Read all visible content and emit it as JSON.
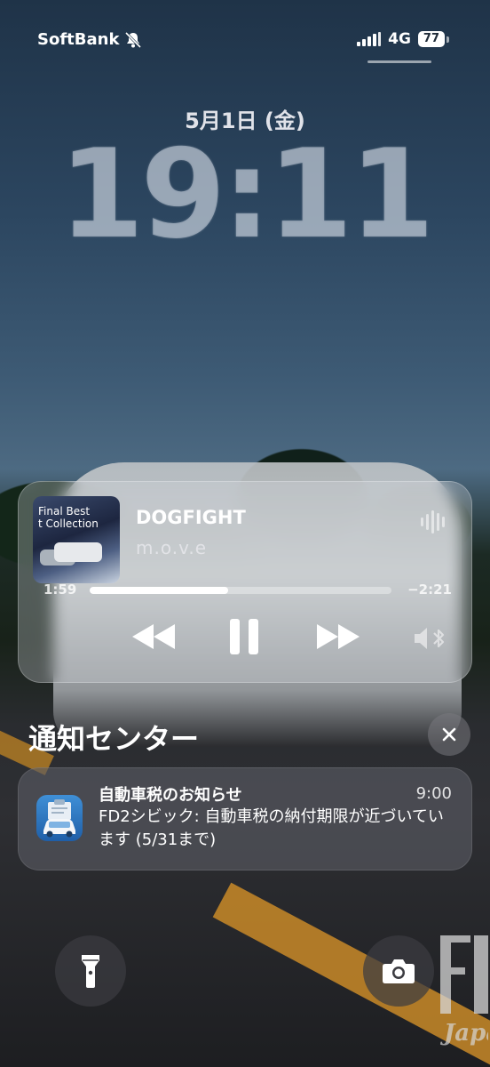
{
  "status_bar": {
    "carrier": "SoftBank",
    "network": "4G",
    "battery": "77",
    "signal_bars": 4
  },
  "lock_screen": {
    "date": "5月1日 (金)",
    "time": "19:11"
  },
  "now_playing": {
    "album_art_text": "Final Best\nt Collection",
    "title": "DOGFIGHT",
    "artist": "m.o.v.e",
    "elapsed": "1:59",
    "remaining": "−2:21",
    "progress_fraction": 0.46
  },
  "notification_center": {
    "title": "通知センター"
  },
  "notification": {
    "app": "自動車税のお知らせ",
    "time": "9:00",
    "body": "FD2シビック: 自動車税の納付期限が近づいています (5/31まで)"
  },
  "colors": {
    "accent_white": "#ffffff",
    "notif_icon": "#2f78c2"
  }
}
